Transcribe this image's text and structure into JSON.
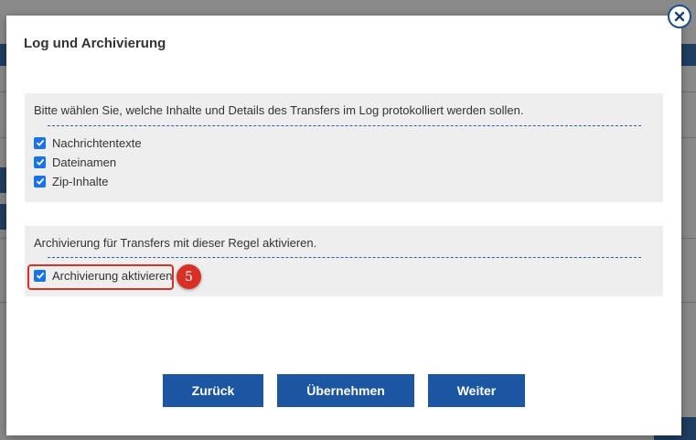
{
  "dialog": {
    "title": "Log und Archivierung",
    "close_icon": "close-icon"
  },
  "log_section": {
    "description": "Bitte wählen Sie, welche Inhalte und Details des Transfers im Log protokolliert werden sollen.",
    "options": [
      {
        "label": "Nachrichtentexte",
        "checked": true
      },
      {
        "label": "Dateinamen",
        "checked": true
      },
      {
        "label": "Zip-Inhalte",
        "checked": true
      }
    ]
  },
  "archive_section": {
    "description": "Archivierung für Transfers mit dieser Regel aktivieren.",
    "option": {
      "label": "Archivierung aktivieren",
      "checked": true
    }
  },
  "annotation": {
    "step": "5",
    "color": "#d93025"
  },
  "buttons": {
    "back": "Zurück",
    "apply": "Übernehmen",
    "next": "Weiter"
  },
  "colors": {
    "accent": "#1c56a3",
    "checkbox": "#1a73e8"
  }
}
